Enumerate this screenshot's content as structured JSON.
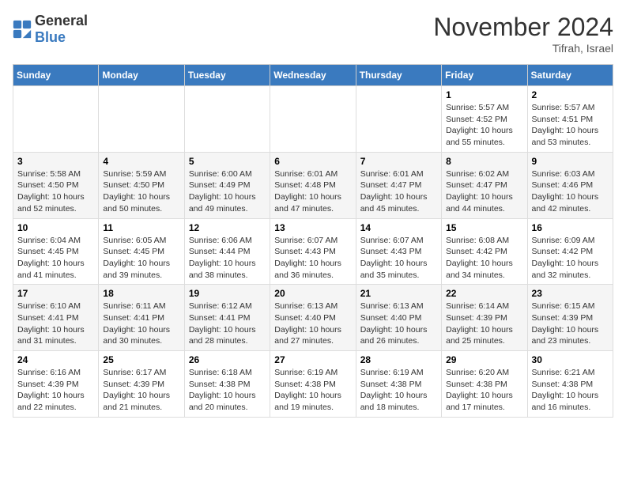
{
  "logo": {
    "general": "General",
    "blue": "Blue"
  },
  "header": {
    "month": "November 2024",
    "location": "Tifrah, Israel"
  },
  "weekdays": [
    "Sunday",
    "Monday",
    "Tuesday",
    "Wednesday",
    "Thursday",
    "Friday",
    "Saturday"
  ],
  "weeks": [
    [
      {
        "day": "",
        "info": ""
      },
      {
        "day": "",
        "info": ""
      },
      {
        "day": "",
        "info": ""
      },
      {
        "day": "",
        "info": ""
      },
      {
        "day": "",
        "info": ""
      },
      {
        "day": "1",
        "info": "Sunrise: 5:57 AM\nSunset: 4:52 PM\nDaylight: 10 hours and 55 minutes."
      },
      {
        "day": "2",
        "info": "Sunrise: 5:57 AM\nSunset: 4:51 PM\nDaylight: 10 hours and 53 minutes."
      }
    ],
    [
      {
        "day": "3",
        "info": "Sunrise: 5:58 AM\nSunset: 4:50 PM\nDaylight: 10 hours and 52 minutes."
      },
      {
        "day": "4",
        "info": "Sunrise: 5:59 AM\nSunset: 4:50 PM\nDaylight: 10 hours and 50 minutes."
      },
      {
        "day": "5",
        "info": "Sunrise: 6:00 AM\nSunset: 4:49 PM\nDaylight: 10 hours and 49 minutes."
      },
      {
        "day": "6",
        "info": "Sunrise: 6:01 AM\nSunset: 4:48 PM\nDaylight: 10 hours and 47 minutes."
      },
      {
        "day": "7",
        "info": "Sunrise: 6:01 AM\nSunset: 4:47 PM\nDaylight: 10 hours and 45 minutes."
      },
      {
        "day": "8",
        "info": "Sunrise: 6:02 AM\nSunset: 4:47 PM\nDaylight: 10 hours and 44 minutes."
      },
      {
        "day": "9",
        "info": "Sunrise: 6:03 AM\nSunset: 4:46 PM\nDaylight: 10 hours and 42 minutes."
      }
    ],
    [
      {
        "day": "10",
        "info": "Sunrise: 6:04 AM\nSunset: 4:45 PM\nDaylight: 10 hours and 41 minutes."
      },
      {
        "day": "11",
        "info": "Sunrise: 6:05 AM\nSunset: 4:45 PM\nDaylight: 10 hours and 39 minutes."
      },
      {
        "day": "12",
        "info": "Sunrise: 6:06 AM\nSunset: 4:44 PM\nDaylight: 10 hours and 38 minutes."
      },
      {
        "day": "13",
        "info": "Sunrise: 6:07 AM\nSunset: 4:43 PM\nDaylight: 10 hours and 36 minutes."
      },
      {
        "day": "14",
        "info": "Sunrise: 6:07 AM\nSunset: 4:43 PM\nDaylight: 10 hours and 35 minutes."
      },
      {
        "day": "15",
        "info": "Sunrise: 6:08 AM\nSunset: 4:42 PM\nDaylight: 10 hours and 34 minutes."
      },
      {
        "day": "16",
        "info": "Sunrise: 6:09 AM\nSunset: 4:42 PM\nDaylight: 10 hours and 32 minutes."
      }
    ],
    [
      {
        "day": "17",
        "info": "Sunrise: 6:10 AM\nSunset: 4:41 PM\nDaylight: 10 hours and 31 minutes."
      },
      {
        "day": "18",
        "info": "Sunrise: 6:11 AM\nSunset: 4:41 PM\nDaylight: 10 hours and 30 minutes."
      },
      {
        "day": "19",
        "info": "Sunrise: 6:12 AM\nSunset: 4:41 PM\nDaylight: 10 hours and 28 minutes."
      },
      {
        "day": "20",
        "info": "Sunrise: 6:13 AM\nSunset: 4:40 PM\nDaylight: 10 hours and 27 minutes."
      },
      {
        "day": "21",
        "info": "Sunrise: 6:13 AM\nSunset: 4:40 PM\nDaylight: 10 hours and 26 minutes."
      },
      {
        "day": "22",
        "info": "Sunrise: 6:14 AM\nSunset: 4:39 PM\nDaylight: 10 hours and 25 minutes."
      },
      {
        "day": "23",
        "info": "Sunrise: 6:15 AM\nSunset: 4:39 PM\nDaylight: 10 hours and 23 minutes."
      }
    ],
    [
      {
        "day": "24",
        "info": "Sunrise: 6:16 AM\nSunset: 4:39 PM\nDaylight: 10 hours and 22 minutes."
      },
      {
        "day": "25",
        "info": "Sunrise: 6:17 AM\nSunset: 4:39 PM\nDaylight: 10 hours and 21 minutes."
      },
      {
        "day": "26",
        "info": "Sunrise: 6:18 AM\nSunset: 4:38 PM\nDaylight: 10 hours and 20 minutes."
      },
      {
        "day": "27",
        "info": "Sunrise: 6:19 AM\nSunset: 4:38 PM\nDaylight: 10 hours and 19 minutes."
      },
      {
        "day": "28",
        "info": "Sunrise: 6:19 AM\nSunset: 4:38 PM\nDaylight: 10 hours and 18 minutes."
      },
      {
        "day": "29",
        "info": "Sunrise: 6:20 AM\nSunset: 4:38 PM\nDaylight: 10 hours and 17 minutes."
      },
      {
        "day": "30",
        "info": "Sunrise: 6:21 AM\nSunset: 4:38 PM\nDaylight: 10 hours and 16 minutes."
      }
    ]
  ]
}
